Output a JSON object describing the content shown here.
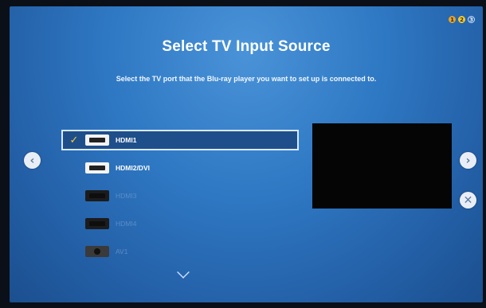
{
  "header": {
    "title": "Select TV Input Source",
    "subtitle": "Select the TV port that the Blu-ray player you want to set up is connected to.",
    "steps": [
      "1",
      "2",
      "3"
    ]
  },
  "sources": [
    {
      "label": "HDMI1",
      "selected": true,
      "enabled": true,
      "icon": "hdmi-port-icon"
    },
    {
      "label": "HDMI2/DVI",
      "selected": false,
      "enabled": true,
      "icon": "hdmi-port-icon"
    },
    {
      "label": "HDMI3",
      "selected": false,
      "enabled": false,
      "icon": "hdmi-port-icon"
    },
    {
      "label": "HDMI4",
      "selected": false,
      "enabled": false,
      "icon": "hdmi-port-icon"
    },
    {
      "label": "AV1",
      "selected": false,
      "enabled": false,
      "icon": "av-port-icon"
    }
  ],
  "nav": {
    "prev_glyph": "‹",
    "next_glyph": "›",
    "close_glyph": "✕",
    "check_glyph": "✓"
  },
  "colors": {
    "background": "#2f79c4",
    "selected_bg": "#1f4f8a",
    "check": "#f4cc33",
    "step_done": "#e4a432",
    "step_current": "#f3cc3a"
  }
}
